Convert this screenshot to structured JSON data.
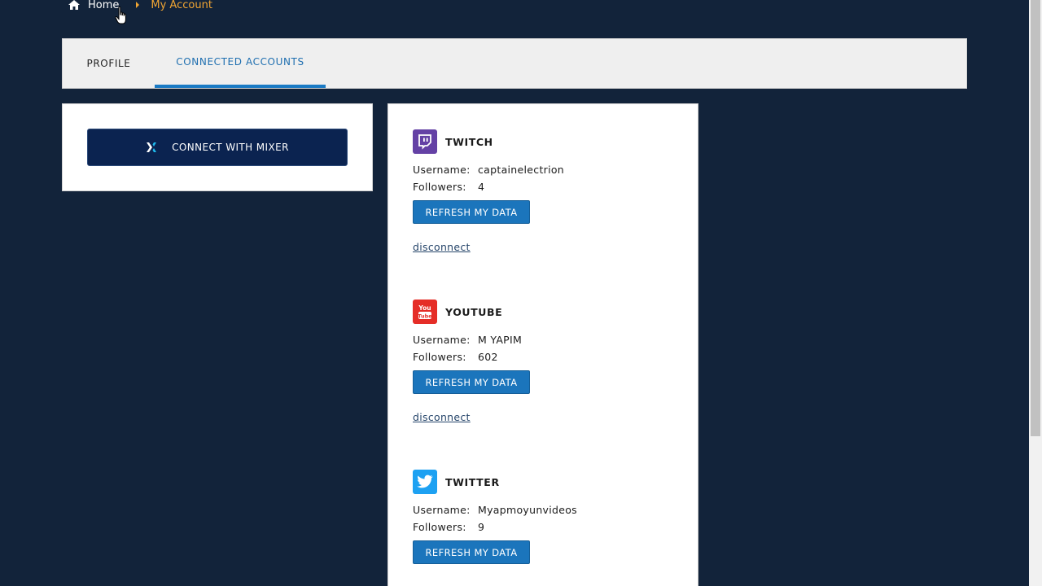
{
  "breadcrumb": {
    "home": "Home",
    "current": "My Account"
  },
  "tabs": [
    {
      "label": "PROFILE"
    },
    {
      "label": "CONNECTED ACCOUNTS",
      "active": true
    }
  ],
  "mixer": {
    "button_label": "CONNECT WITH MIXER",
    "icon": "mixer-icon"
  },
  "accounts": [
    {
      "platform": "TWITCH",
      "icon": "twitch-icon",
      "color": "#6441a5",
      "username_label": "Username:",
      "username": "captainelectrion",
      "followers_label": "Followers:",
      "followers": "4",
      "refresh_label": "REFRESH MY DATA",
      "disconnect_label": "disconnect"
    },
    {
      "platform": "YOUTUBE",
      "icon": "youtube-icon",
      "color": "#e52d27",
      "username_label": "Username:",
      "username": "M YAPIM",
      "followers_label": "Followers:",
      "followers": "602",
      "refresh_label": "REFRESH MY DATA",
      "disconnect_label": "disconnect"
    },
    {
      "platform": "TWITTER",
      "icon": "twitter-icon",
      "color": "#1da1f2",
      "username_label": "Username:",
      "username": "Myapmoyunvideos",
      "followers_label": "Followers:",
      "followers": "9",
      "refresh_label": "REFRESH MY DATA"
    }
  ],
  "colors": {
    "page_bg": "#12233a",
    "accent_orange": "#f0a533",
    "tab_active": "#1a7ac4",
    "button_blue": "#1b75bc",
    "mixer_navy": "#0b2350"
  }
}
